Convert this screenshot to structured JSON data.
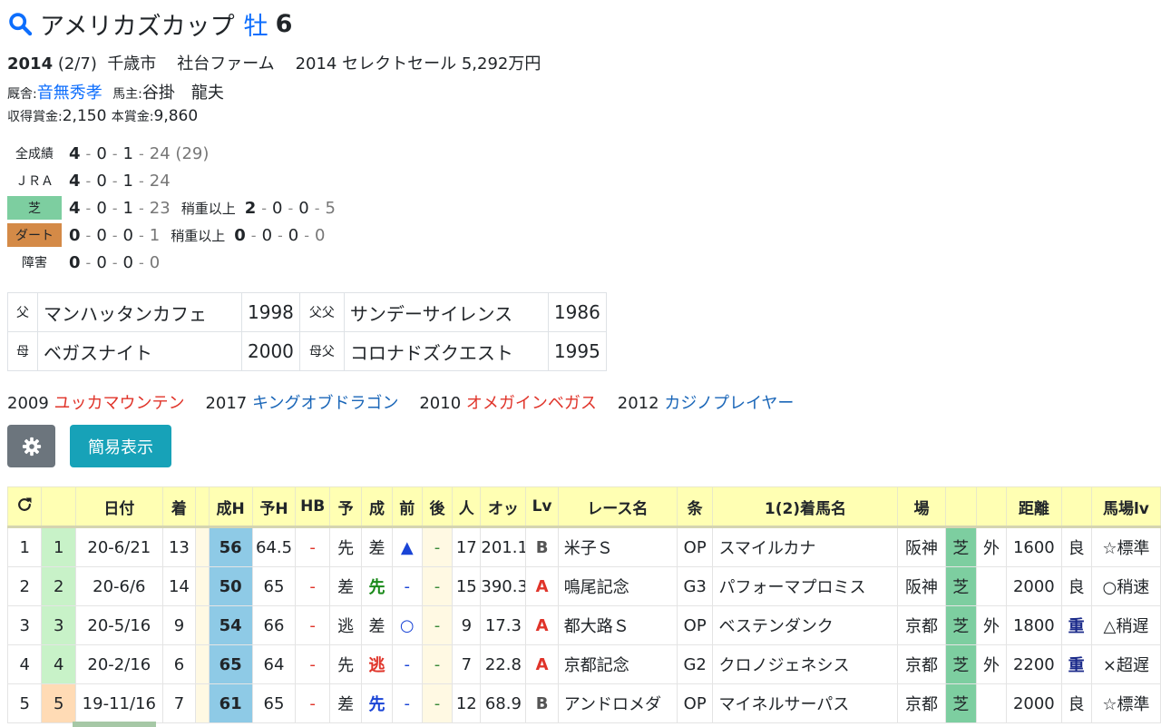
{
  "header": {
    "name": "アメリカズカップ",
    "sex": "牡",
    "age": "6"
  },
  "profile": {
    "birth_year": "2014",
    "birth_date": " (2/7)",
    "birthplace": "千歳市",
    "breeder": "社台ファーム",
    "sale": "2014 セレクトセール 5,292万円",
    "stable_label": "厩舎:",
    "stable": "音無秀孝",
    "owner_label": "馬主:",
    "owner": "谷掛　龍夫",
    "earn_label1": "収得賞金:",
    "earn1": "2,150",
    "earn_label2": "本賞金:",
    "earn2": "9,860"
  },
  "records": {
    "all": {
      "label": "全成績",
      "w": "4",
      "s": "0",
      "t": "1",
      "o": "24",
      "extra": "(29)"
    },
    "jra": {
      "label": "ＪＲＡ",
      "w": "4",
      "s": "0",
      "t": "1",
      "o": "24"
    },
    "turf": {
      "label": "芝",
      "w": "4",
      "s": "0",
      "t": "1",
      "o": "23",
      "sub_label": "稍重以上",
      "sw": "2",
      "ss": "0",
      "st": "0",
      "so": "5"
    },
    "dirt": {
      "label": "ダート",
      "w": "0",
      "s": "0",
      "t": "0",
      "o": "1",
      "sub_label": "稍重以上",
      "sw": "0",
      "ss": "0",
      "st": "0",
      "so": "0"
    },
    "jump": {
      "label": "障害",
      "w": "0",
      "s": "0",
      "t": "0",
      "o": "0"
    }
  },
  "pedigree": {
    "sire_label": "父",
    "sire": "マンハッタンカフェ",
    "sire_year": "1998",
    "sire_sire_label": "父父",
    "sire_sire": "サンデーサイレンス",
    "sire_sire_year": "1986",
    "dam_label": "母",
    "dam": "ベガスナイト",
    "dam_year": "2000",
    "dam_sire_label": "母父",
    "dam_sire": "コロナドズクエスト",
    "dam_sire_year": "1995"
  },
  "progeny": [
    {
      "year": "2009",
      "name": "ユッカマウンテン",
      "color": "#e0342a"
    },
    {
      "year": "2017",
      "name": "キングオブドラゴン",
      "color": "#1a66b8"
    },
    {
      "year": "2010",
      "name": "オメガインベガス",
      "color": "#e0342a"
    },
    {
      "year": "2012",
      "name": "カジノプレイヤー",
      "color": "#1a66b8"
    }
  ],
  "buttons": {
    "settings_icon": "gear-icon",
    "simple": "簡易表示"
  },
  "table": {
    "headers": [
      "",
      "",
      "日付",
      "着",
      "成H",
      "予H",
      "HB",
      "予",
      "成",
      "前",
      "後",
      "人",
      "オッ",
      "Lv",
      "レース名",
      "条",
      "1(2)着馬名",
      "場",
      "",
      "",
      "距離",
      "",
      "馬場lv"
    ],
    "rows": [
      {
        "no": "1",
        "n2": "1",
        "date": "20-6/21",
        "rank": "13",
        "sH": "56",
        "yH": "64.5",
        "hb": "-",
        "yo": "先",
        "sei": "差",
        "mae": "▲",
        "ato": "-",
        "pop": "17",
        "odds": "201.1",
        "lv": "B",
        "race": "米子Ｓ",
        "cls": "OP",
        "winner": "スマイルカナ",
        "track": "阪神",
        "surf": "芝",
        "io": "外",
        "dist": "1600",
        "cond": "良",
        "blv": "☆標準"
      },
      {
        "no": "2",
        "n2": "2",
        "date": "20-6/6",
        "rank": "14",
        "sH": "50",
        "yH": "65",
        "hb": "-",
        "yo": "差",
        "sei": "先",
        "mae": "-",
        "ato": "-",
        "pop": "15",
        "odds": "390.3",
        "lv": "A",
        "race": "鳴尾記念",
        "cls": "G3",
        "winner": "パフォーマプロミス",
        "track": "阪神",
        "surf": "芝",
        "io": "",
        "dist": "2000",
        "cond": "良",
        "blv": "○稍速"
      },
      {
        "no": "3",
        "n2": "3",
        "date": "20-5/16",
        "rank": "9",
        "sH": "54",
        "yH": "66",
        "hb": "-",
        "yo": "逃",
        "sei": "差",
        "mae": "○",
        "ato": "-",
        "pop": "9",
        "odds": "17.3",
        "lv": "A",
        "race": "都大路Ｓ",
        "cls": "OP",
        "winner": "ベステンダンク",
        "track": "京都",
        "surf": "芝",
        "io": "外",
        "dist": "1800",
        "cond": "重",
        "blv": "△稍遅"
      },
      {
        "no": "4",
        "n2": "4",
        "date": "20-2/16",
        "rank": "6",
        "sH": "65",
        "yH": "64",
        "hb": "-",
        "yo": "先",
        "sei": "逃",
        "mae": "-",
        "ato": "-",
        "pop": "7",
        "odds": "22.8",
        "lv": "A",
        "race": "京都記念",
        "cls": "G2",
        "winner": "クロノジェネシス",
        "track": "京都",
        "surf": "芝",
        "io": "外",
        "dist": "2200",
        "cond": "重",
        "blv": "×超遅"
      },
      {
        "no": "5",
        "n2": "5",
        "date": "19-11/16",
        "rank": "7",
        "sH": "61",
        "yH": "65",
        "hb": "-",
        "yo": "差",
        "sei": "先",
        "mae": "-",
        "ato": "-",
        "pop": "12",
        "odds": "68.9",
        "lv": "B",
        "race": "アンドロメダ",
        "cls": "OP",
        "winner": "マイネルサーパス",
        "track": "京都",
        "surf": "芝",
        "io": "",
        "dist": "2000",
        "cond": "良",
        "blv": "☆標準"
      }
    ]
  }
}
